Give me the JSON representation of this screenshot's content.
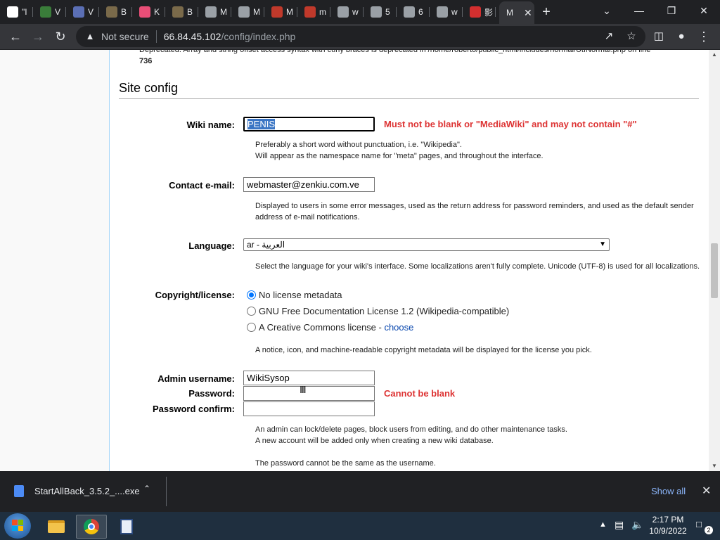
{
  "tabs": [
    {
      "letter": "\"I",
      "color": "#ffffff"
    },
    {
      "letter": "V",
      "color": "#3a7d3a"
    },
    {
      "letter": "V",
      "color": "#5b6fb5"
    },
    {
      "letter": "B",
      "color": "#7a6a4a"
    },
    {
      "letter": "K",
      "color": "#e94e77"
    },
    {
      "letter": "B",
      "color": "#7a6a4a"
    },
    {
      "letter": "M",
      "color": "#9aa0a6"
    },
    {
      "letter": "M",
      "color": "#9aa0a6"
    },
    {
      "letter": "M",
      "color": "#c0392b"
    },
    {
      "letter": "m",
      "color": "#c0392b"
    },
    {
      "letter": "w",
      "color": "#9aa0a6"
    },
    {
      "letter": "5",
      "color": "#9aa0a6"
    },
    {
      "letter": "6",
      "color": "#9aa0a6"
    },
    {
      "letter": "w",
      "color": "#9aa0a6"
    },
    {
      "letter": "影",
      "color": "#d32f2f"
    }
  ],
  "active_tab": {
    "label": "M",
    "close": "✕"
  },
  "browser": {
    "not_secure": "Not secure",
    "url_host": "66.84.45.102",
    "url_path": "/config/index.php",
    "new_tab": "+"
  },
  "page": {
    "deprecated_line1": "Deprecated: Array and string offset access syntax with curly braces is deprecated in /home/roberto/public_html/includes/normal/UtfNormal.php on line",
    "deprecated_line2": "736",
    "section_title": "Site config",
    "wiki_name_label": "Wiki name:",
    "wiki_name_value": "PENIS",
    "wiki_name_error": "Must not be blank or \"MediaWiki\" and may not contain \"#\"",
    "wiki_name_help1": "Preferably a short word without punctuation, i.e. \"Wikipedia\".",
    "wiki_name_help2": "Will appear as the namespace name for \"meta\" pages, and throughout the interface.",
    "contact_label": "Contact e-mail:",
    "contact_value": "webmaster@zenkiu.com.ve",
    "contact_help1": "Displayed to users in some error messages, used as the return address for password reminders, and used as the default sender",
    "contact_help2": "address of e-mail notifications.",
    "language_label": "Language:",
    "language_value": "ar - العربية",
    "language_help": "Select the language for your wiki's interface. Some localizations aren't fully complete. Unicode (UTF-8) is used for all localizations.",
    "copyright_label": "Copyright/license:",
    "license_options": [
      {
        "label": "No license metadata",
        "selected": true
      },
      {
        "label": "GNU Free Documentation License 1.2 (Wikipedia-compatible)",
        "selected": false
      },
      {
        "label": "A Creative Commons license - ",
        "link": "choose",
        "selected": false
      }
    ],
    "license_help": "A notice, icon, and machine-readable copyright metadata will be displayed for the license you pick.",
    "admin_label": "Admin username:",
    "admin_value": "WikiSysop",
    "password_label": "Password:",
    "password_error": "Cannot be blank",
    "password_confirm_label": "Password confirm:",
    "admin_help1": "An admin can lock/delete pages, block users from editing, and do other maintenance tasks.",
    "admin_help2": "A new account will be added only when creating a new wiki database.",
    "admin_help3": "The password cannot be the same as the username."
  },
  "download": {
    "filename": "StartAllBack_3.5.2_....exe",
    "show_all": "Show all"
  },
  "taskbar": {
    "time": "2:17 PM",
    "date": "10/9/2022",
    "notif_count": "2"
  }
}
